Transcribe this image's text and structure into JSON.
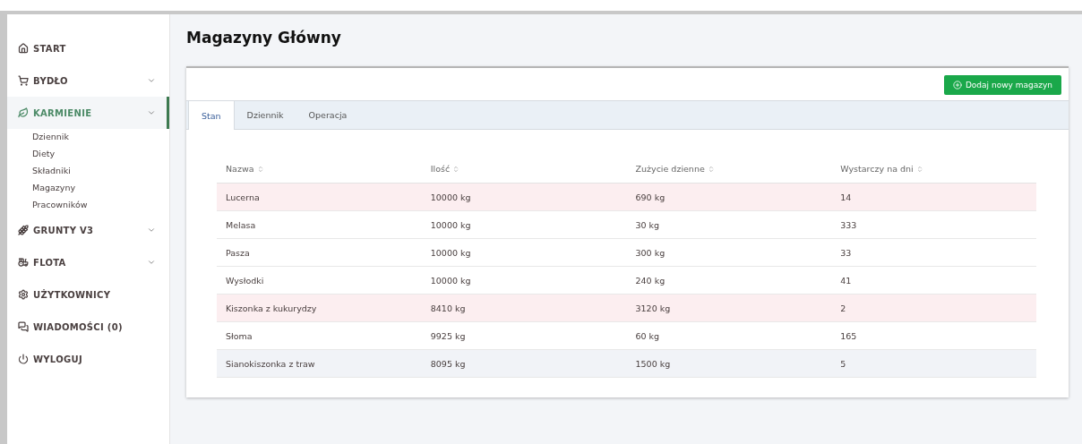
{
  "sidebar": {
    "items": [
      {
        "label": "START",
        "expandable": false,
        "selected": false
      },
      {
        "label": "BYDŁO",
        "expandable": true,
        "selected": false
      },
      {
        "label": "KARMIENIE",
        "expandable": true,
        "selected": true,
        "children": [
          {
            "label": "Dziennik"
          },
          {
            "label": "Diety"
          },
          {
            "label": "Składniki"
          },
          {
            "label": "Magazyny"
          },
          {
            "label": "Pracowników"
          }
        ]
      },
      {
        "label": "GRUNTY V3",
        "expandable": true,
        "selected": false
      },
      {
        "label": "FLOTA",
        "expandable": true,
        "selected": false
      },
      {
        "label": "UŻYTKOWNICY",
        "expandable": false,
        "selected": false
      },
      {
        "label": "WIADOMOŚCI (0)",
        "expandable": false,
        "selected": false
      },
      {
        "label": "WYLOGUJ",
        "expandable": false,
        "selected": false
      }
    ]
  },
  "page_title": "Magazyny Główny",
  "add_button": "Dodaj nowy magazyn",
  "tabs": [
    {
      "label": "Stan",
      "selected": true
    },
    {
      "label": "Dziennik",
      "selected": false
    },
    {
      "label": "Operacja",
      "selected": false
    }
  ],
  "table": {
    "columns": [
      "Nazwa",
      "Ilość",
      "Zużycie dzienne",
      "Wystarczy na dni"
    ],
    "rows": [
      {
        "cells": [
          "Lucerna",
          "10000 kg",
          "690 kg",
          "14"
        ],
        "color": "#fceef0"
      },
      {
        "cells": [
          "Melasa",
          "10000 kg",
          "30 kg",
          "333"
        ],
        "color": "#ffffff"
      },
      {
        "cells": [
          "Pasza",
          "10000 kg",
          "300 kg",
          "33"
        ],
        "color": "#ffffff"
      },
      {
        "cells": [
          "Wysłodki",
          "10000 kg",
          "240 kg",
          "41"
        ],
        "color": "#ffffff"
      },
      {
        "cells": [
          "Kiszonka z kukurydzy",
          "8410 kg",
          "3120 kg",
          "2"
        ],
        "color": "#fceef0"
      },
      {
        "cells": [
          "Słoma",
          "9925 kg",
          "60 kg",
          "165"
        ],
        "color": "#ffffff"
      },
      {
        "cells": [
          "Sianokiszonka z traw",
          "8095 kg",
          "1500 kg",
          "5"
        ],
        "color": "#f1f3f7"
      }
    ]
  }
}
